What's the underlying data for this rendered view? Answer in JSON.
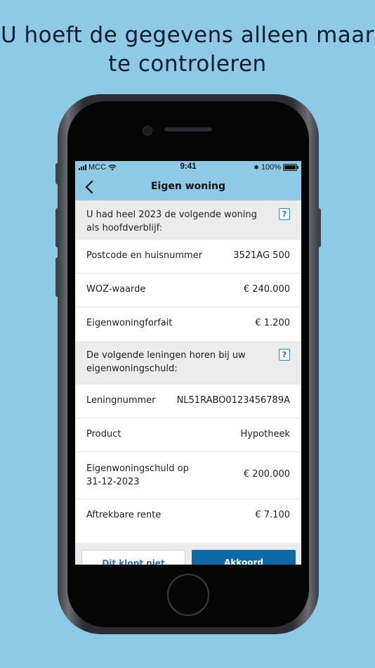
{
  "headline": {
    "line1": "U hoeft de gegevens alleen maar",
    "line2": "te controleren"
  },
  "status_bar": {
    "carrier": "MCC",
    "time": "9:41",
    "bluetooth": "✱",
    "battery": "100%"
  },
  "nav": {
    "title": "Eigen woning",
    "back_icon": "chevron-left-icon"
  },
  "sections": [
    {
      "header": "U had heel 2023 de volgende woning als hoofdverblijf:",
      "help": "?",
      "rows": [
        {
          "label": "Postcode en huisnummer",
          "value": "3521AG 500"
        },
        {
          "label": "WOZ-waarde",
          "value": "€ 240.000"
        },
        {
          "label": "Eigenwoningforfait",
          "value": "€ 1.200"
        }
      ]
    },
    {
      "header": "De volgende leningen horen bij uw eigenwoningschuld:",
      "help": "?",
      "rows": [
        {
          "label": "Leningnummer",
          "value": "NL51RABO0123456789A"
        },
        {
          "label": "Product",
          "value": "Hypotheek"
        },
        {
          "label": "Eigenwoningschuld op",
          "label_line2": "31-12-2023",
          "value": "€ 200.000"
        },
        {
          "label": "Aftrekbare rente",
          "value": "€ 7.100"
        }
      ]
    }
  ],
  "buttons": {
    "secondary": "Dit klopt niet",
    "primary": "Akkoord"
  },
  "colors": {
    "background": "#8ec9e6",
    "primary_button": "#0e6aa6",
    "help_icon": "#2f6fb4"
  }
}
